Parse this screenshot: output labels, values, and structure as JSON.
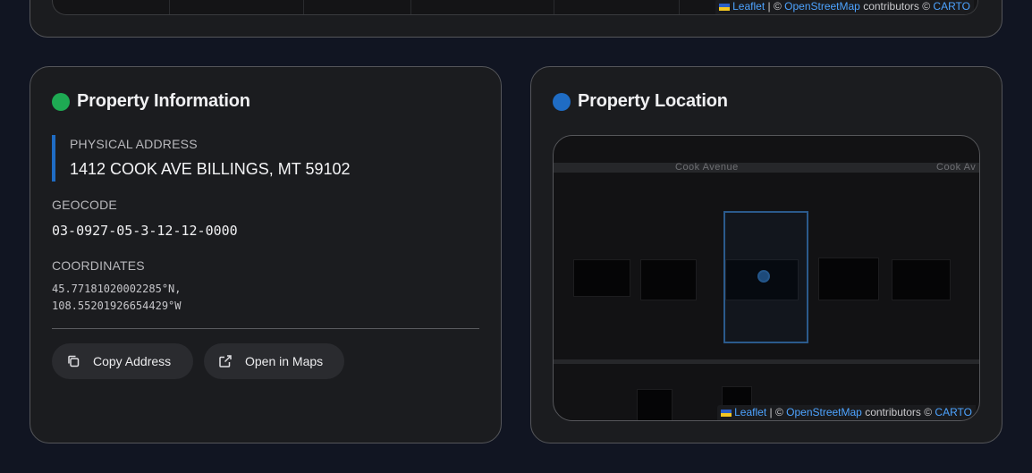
{
  "top_map": {
    "attribution": {
      "leaflet": "Leaflet",
      "separator": "| ©",
      "osm": "OpenStreetMap",
      "contributors": "contributors ©",
      "carto": "CARTO"
    }
  },
  "property_info": {
    "title": "Property Information",
    "accent_color": "#1eaa53",
    "physical_address_label": "PHYSICAL ADDRESS",
    "physical_address": "1412 COOK AVE BILLINGS, MT 59102",
    "geocode_label": "GEOCODE",
    "geocode": "03-0927-05-3-12-12-0000",
    "coordinates_label": "COORDINATES",
    "latitude": "45.77181020002285°N,",
    "longitude": "108.55201926654429°W",
    "buttons": {
      "copy_address": {
        "label": "Copy Address",
        "icon": "copy-icon"
      },
      "open_in_maps": {
        "label": "Open in Maps",
        "icon": "external-link-icon"
      }
    }
  },
  "property_location": {
    "title": "Property Location",
    "accent_color": "#1f6cc4",
    "map": {
      "street_label_1": "Cook Avenue",
      "street_label_2": "Cook Av",
      "attribution": {
        "leaflet": "Leaflet",
        "separator": "| ©",
        "osm": "OpenStreetMap",
        "contributors": "contributors ©",
        "carto": "CARTO"
      }
    }
  }
}
